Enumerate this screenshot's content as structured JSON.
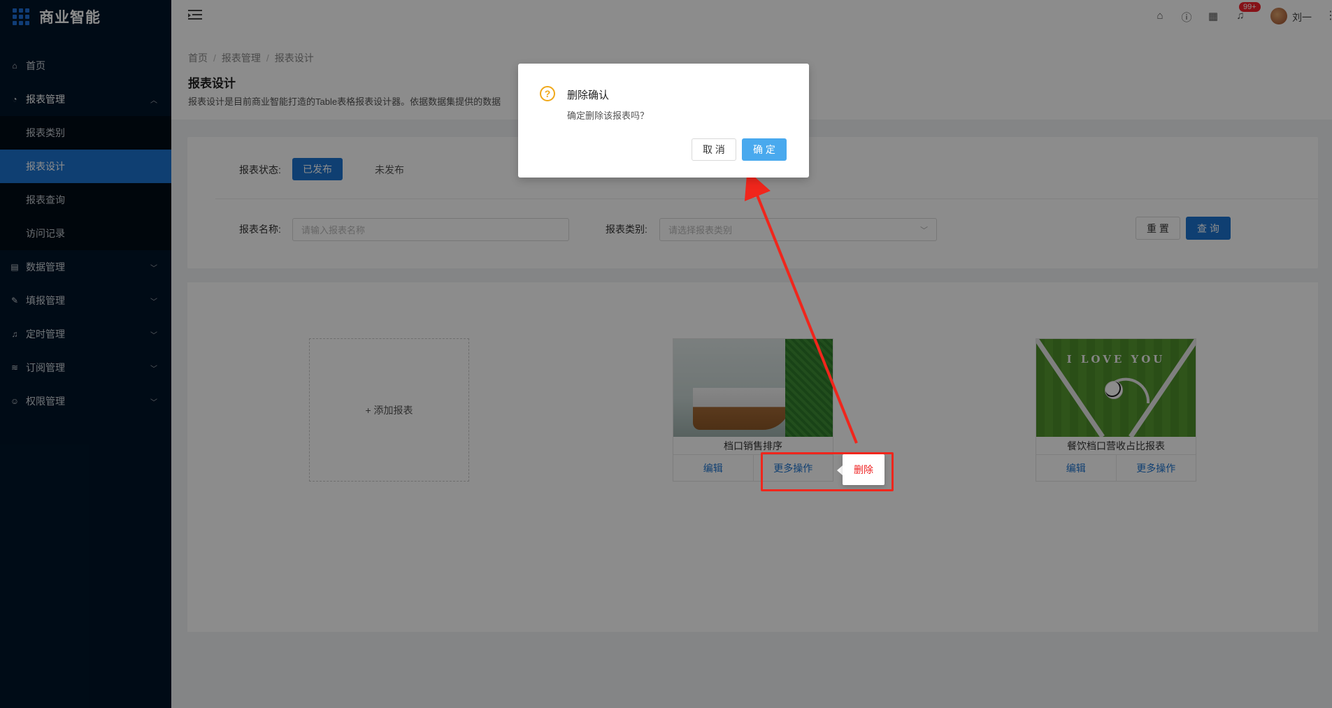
{
  "app": {
    "title": "商业智能"
  },
  "sidebar": {
    "items": [
      {
        "label": "首页",
        "icon": "home-icon"
      },
      {
        "label": "报表管理",
        "icon": "dashboard-icon",
        "expanded": true,
        "children": [
          {
            "label": "报表类别"
          },
          {
            "label": "报表设计",
            "active": true
          },
          {
            "label": "报表查询"
          },
          {
            "label": "访问记录"
          }
        ]
      },
      {
        "label": "数据管理",
        "icon": "database-icon"
      },
      {
        "label": "填报管理",
        "icon": "edit-icon"
      },
      {
        "label": "定时管理",
        "icon": "bell-icon"
      },
      {
        "label": "订阅管理",
        "icon": "wifi-icon"
      },
      {
        "label": "权限管理",
        "icon": "user-icon"
      }
    ]
  },
  "header": {
    "notifications_badge": "99+",
    "user_name": "刘一"
  },
  "breadcrumb": [
    "首页",
    "报表管理",
    "报表设计"
  ],
  "page": {
    "title": "报表设计",
    "description": "报表设计是目前商业智能打造的Table表格报表设计器。依据数据集提供的数据"
  },
  "filters": {
    "status_label": "报表状态:",
    "status_options": [
      "已发布",
      "未发布"
    ],
    "status_selected": "已发布",
    "name_label": "报表名称:",
    "name_placeholder": "请输入报表名称",
    "category_label": "报表类别:",
    "category_placeholder": "请选择报表类别",
    "reset_label": "重 置",
    "query_label": "查 询"
  },
  "reports": {
    "add_label": "+ 添加报表",
    "edit_label": "编辑",
    "more_label": "更多操作",
    "cards": [
      {
        "title": "档口销售排序",
        "image": "office-reception"
      },
      {
        "title": "餐饮档口营收占比报表",
        "image": "soccer-field",
        "image_text": "I LOVE YOU"
      }
    ]
  },
  "more_menu": {
    "delete_label": "删除"
  },
  "dialog": {
    "title": "删除确认",
    "body": "确定删除该报表吗？",
    "cancel_label": "取 消",
    "ok_label": "确 定"
  },
  "colors": {
    "sidebar_bg": "#001529",
    "primary": "#1d74d0",
    "annotation": "#f0261c",
    "warning": "#f0a81a"
  }
}
